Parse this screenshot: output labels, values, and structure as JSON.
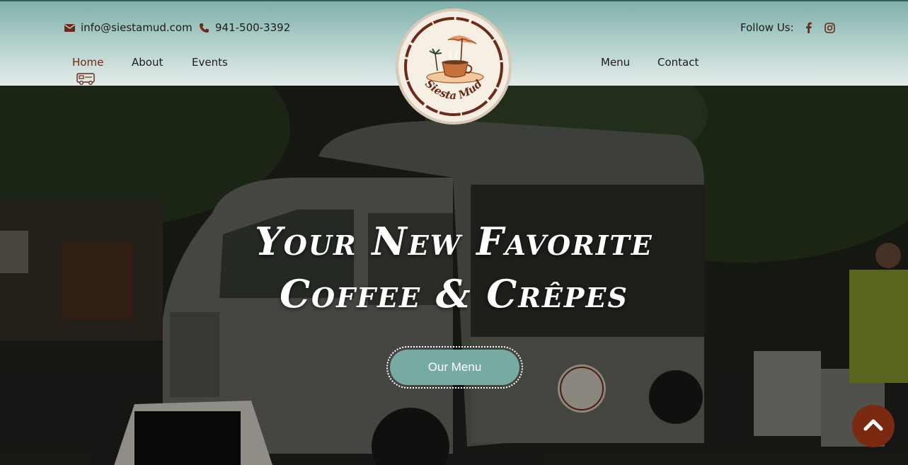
{
  "header": {
    "email": "info@siestamud.com",
    "phone": "941-500-3392",
    "follow_label": "Follow Us:"
  },
  "nav": {
    "home": "Home",
    "about": "About",
    "events": "Events",
    "menu": "Menu",
    "contact": "Contact"
  },
  "logo": {
    "text": "Siesta Mud"
  },
  "hero": {
    "title_line1": "Your New Favorite",
    "title_line2": "Coffee & Crêpes",
    "button": "Our Menu"
  },
  "colors": {
    "accent": "#76aaa3",
    "brand_brown": "#6d2a16",
    "scroll_button": "#7a2a10"
  },
  "icons": [
    "envelope-icon",
    "phone-icon",
    "facebook-icon",
    "instagram-icon",
    "food-truck-icon",
    "chevron-up-icon"
  ]
}
